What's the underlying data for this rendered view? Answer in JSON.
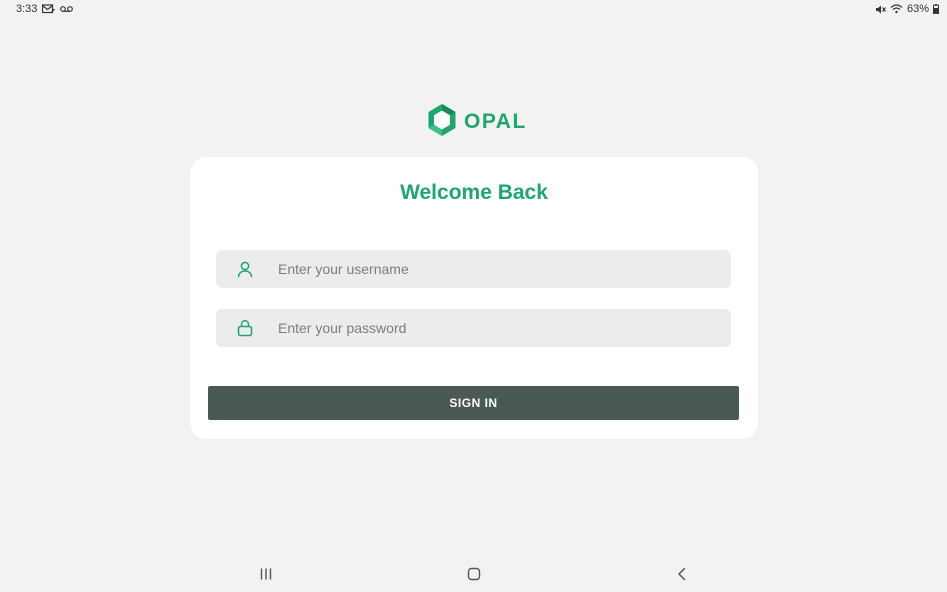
{
  "status_bar": {
    "time": "3:33",
    "battery": "63%",
    "icons": [
      "mail-icon",
      "voicemail-icon",
      "mute-icon",
      "wifi-icon",
      "battery-icon"
    ]
  },
  "logo": {
    "text": "OPAL",
    "icon": "hexagon-logo-icon",
    "color": "#1fa56e"
  },
  "login": {
    "title": "Welcome Back",
    "username": {
      "value": "",
      "placeholder": "Enter your username",
      "icon": "user-icon"
    },
    "password": {
      "value": "",
      "placeholder": "Enter your password",
      "icon": "lock-icon"
    },
    "signin_label": "SIGN IN",
    "button_color": "#4b5953"
  },
  "nav_bar": {
    "buttons": [
      "recents-icon",
      "home-icon",
      "back-icon"
    ]
  }
}
